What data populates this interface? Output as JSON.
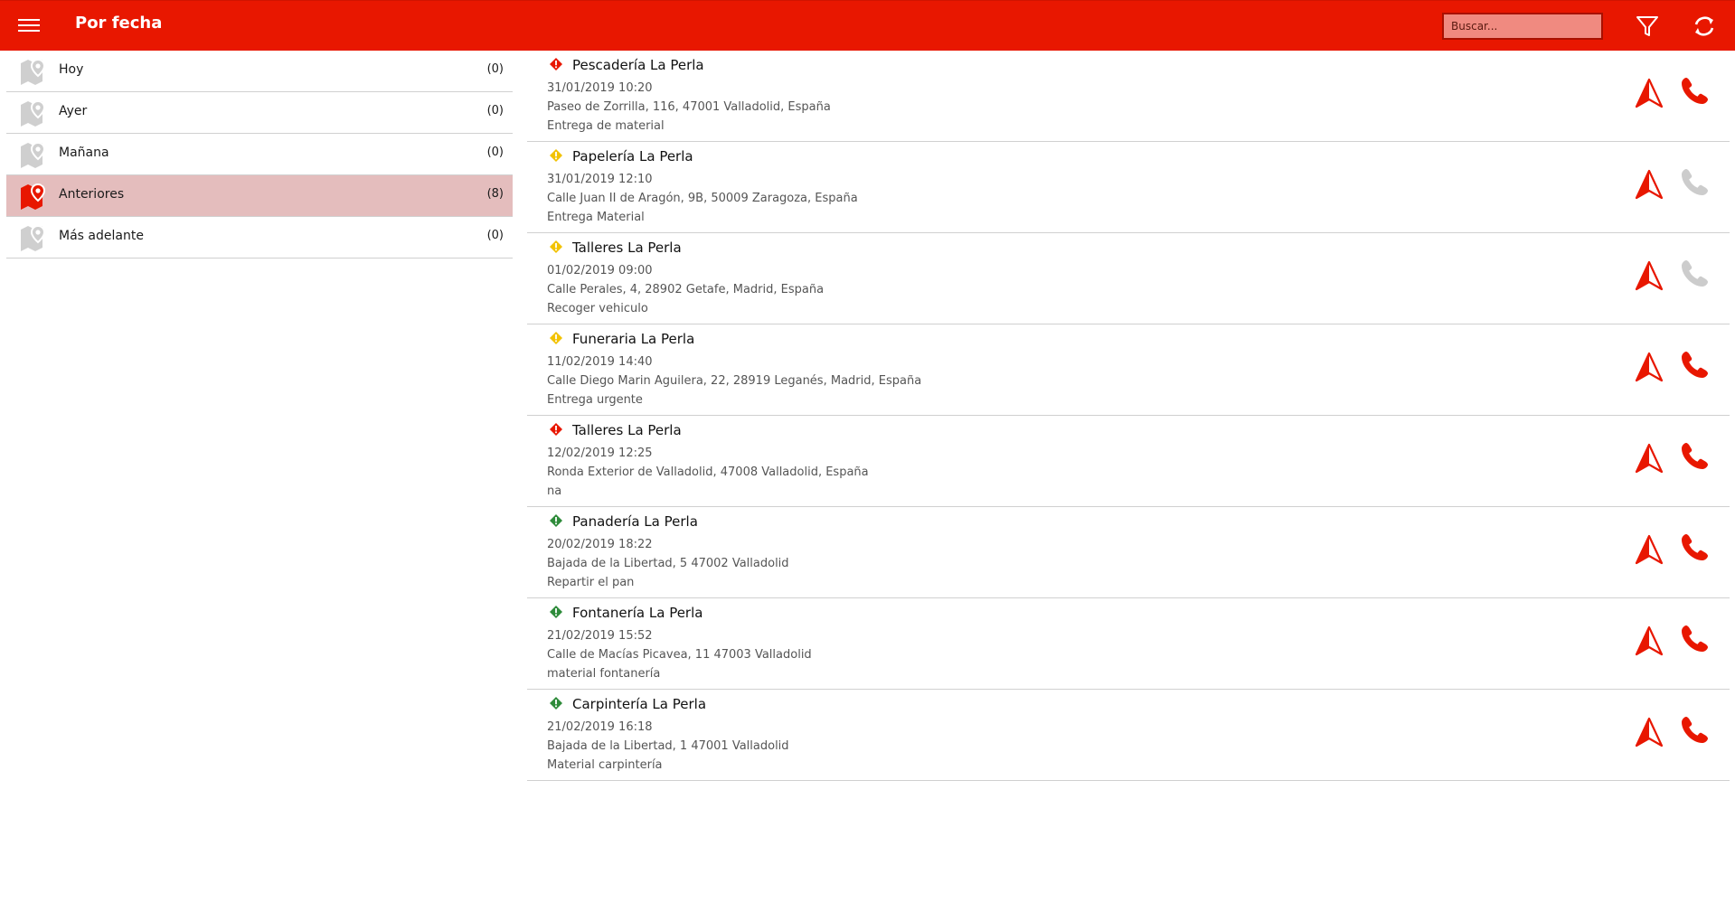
{
  "app": {
    "title": "Por fecha",
    "accent_color": "#e81700",
    "search_placeholder": "Buscar...",
    "icons": {
      "menu": "hamburger-icon",
      "filter": "filter-icon",
      "refresh": "refresh-icon"
    }
  },
  "sidebar": {
    "items": [
      {
        "label": "Hoy",
        "count": "(0)",
        "active": false
      },
      {
        "label": "Ayer",
        "count": "(0)",
        "active": false
      },
      {
        "label": "Mañana",
        "count": "(0)",
        "active": false
      },
      {
        "label": "Anteriores",
        "count": "(8)",
        "active": true
      },
      {
        "label": "Más adelante",
        "count": "(0)",
        "active": false
      }
    ]
  },
  "entries": [
    {
      "name": "Pescadería La Perla",
      "date": "31/01/2019 10:20",
      "address": "Paseo de Zorrilla, 116, 47001 Valladolid, España",
      "description": "Entrega de material",
      "status_color": "#e81700",
      "phone_enabled": true
    },
    {
      "name": "Papelería La Perla",
      "date": "31/01/2019 12:10",
      "address": "Calle Juan II de Aragón, 9B, 50009 Zaragoza, España",
      "description": "Entrega Material",
      "status_color": "#f2c200",
      "phone_enabled": false
    },
    {
      "name": "Talleres La Perla",
      "date": "01/02/2019 09:00",
      "address": "Calle Perales, 4, 28902 Getafe, Madrid, España",
      "description": "Recoger vehiculo",
      "status_color": "#f2c200",
      "phone_enabled": false
    },
    {
      "name": "Funeraria La Perla",
      "date": "11/02/2019 14:40",
      "address": "Calle Diego Marin Aguilera, 22, 28919 Leganés, Madrid, España",
      "description": "Entrega urgente",
      "status_color": "#f2c200",
      "phone_enabled": true
    },
    {
      "name": "Talleres La Perla",
      "date": "12/02/2019 12:25",
      "address": "Ronda Exterior de Valladolid, 47008 Valladolid, España",
      "description": "na",
      "status_color": "#e81700",
      "phone_enabled": true
    },
    {
      "name": "Panadería La Perla",
      "date": "20/02/2019 18:22",
      "address": "Bajada de la Libertad, 5 47002 Valladolid",
      "description": "Repartir el pan",
      "status_color": "#2e8b3a",
      "phone_enabled": true
    },
    {
      "name": "Fontanería La Perla",
      "date": "21/02/2019 15:52",
      "address": "Calle de Macías Picavea, 11 47003 Valladolid",
      "description": "material fontanería",
      "status_color": "#2e8b3a",
      "phone_enabled": true
    },
    {
      "name": "Carpintería La Perla",
      "date": "21/02/2019 16:18",
      "address": "Bajada de la Libertad, 1 47001 Valladolid",
      "description": "Material carpintería",
      "status_color": "#2e8b3a",
      "phone_enabled": true
    }
  ]
}
